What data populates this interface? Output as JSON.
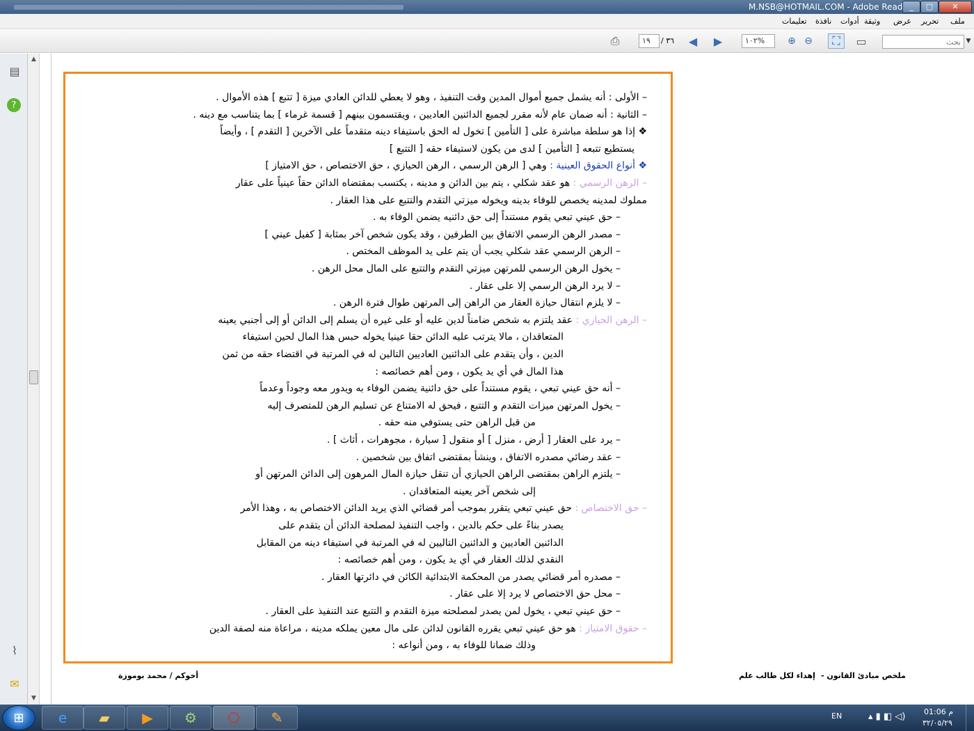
{
  "window": {
    "title": "M.NSB@HOTMAIL.COM - Adobe Reader",
    "min": "_",
    "max": "□",
    "close": "✕"
  },
  "menu": [
    "ملف",
    "تحرير",
    "عرض",
    "وثيقة",
    "أدوات",
    "نافذة",
    "تعليمات"
  ],
  "toolbar": {
    "page_current": "١٩",
    "page_total": "/ ٣٦",
    "zoom": "١٠٢%",
    "search_placeholder": "بحث"
  },
  "doc": {
    "lines": [
      {
        "t": "–   الأولى : أنه يشمل جميع أموال المدين وقت التنفيذ ، وهو لا يعطي للدائن العادي ميزة [ تتبع ] هذه الأموال ."
      },
      {
        "t": "–   الثانية : أنه ضمان عام لأنه مقرر لجميع الدائنين العاديين ، ويقتسمون بينهم [ قسمة غرماء ] بما يتناسب مع دينه ."
      },
      {
        "t": "❖ إذا هو سلطة مباشرة على [ التأمين ] تخول له الحق باستيفاء دينه متقدماً على الآخرين [ التقدم ] ، وأيضاً"
      },
      {
        "t": "يستطيع تتبعه [ التأمين ] لدى من يكون لاستيفاء حقه [ التتبع ]",
        "r": 18
      },
      {
        "h": "❖ أنواع الحقوق العينية : ",
        "hc": "hd2",
        "t": "وهي [ الرهن الرسمي ، الرهن الحيازي ، حق الاختصاص ، حق الامتياز ]"
      },
      {
        "h": "–   الرهن الرسمي : ",
        "hc": "hd",
        "t": "هو عقد شكلي ، يتم بين الدائن و مدينه ، يكتسب بمقتضاه الدائن حقاً عينياً على عقار"
      },
      {
        "t": "مملوك لمدينه يخصص للوفاء بدينه ويخوله ميزتي التقدم والتتبع على هذا العقار .",
        "r": 0
      },
      {
        "t": "–   حق عيني تبعي يقوم مستنداً إلى حق دائنيه يضمن الوفاء به .",
        "r": 38
      },
      {
        "t": "–   مصدر الرهن الرسمي الاتفاق بين الطرفين ، وقد يكون شخص آخر بمثابة [ كفيل عيني ]",
        "r": 38
      },
      {
        "t": "–   الرهن الرسمي عقد شكلي يجب أن يتم على يد الموظف المختص .",
        "r": 38
      },
      {
        "t": "–   يخول الرهن الرسمي للمرتهن ميزتي التقدم والتتبع على المال محل الرهن .",
        "r": 38
      },
      {
        "t": "–   لا يرد الرهن الرسمي إلا على عقار .",
        "r": 38
      },
      {
        "t": "–   لا يلزم انتقال حيازة العقار من الراهن إلى المرتهن طوال فترة الرهن .",
        "r": 38
      },
      {
        "h": "–   الرهن الحيازي : ",
        "hc": "hd",
        "t": "عقد يلتزم به شخص ضامناً لدين عليه أو على غيره أن يسلم إلى الدائن أو إلى أجنبي يعينه"
      },
      {
        "t": "المتعاقدان ، مالا يترتب عليه الدائن حقا عينيا يخوله حبس هذا المال لحين استيفاء",
        "r": 120
      },
      {
        "t": "الدين ، وأن يتقدم على الدائنين العاديين التالين له في المرتبة في اقتضاء حقه من ثمن",
        "r": 120
      },
      {
        "t": "هذا المال في أي يد يكون ، ومن أهم خصائصه :",
        "r": 120
      },
      {
        "t": "–   أنه حق عيني تبعي ، يقوم مستنداً على حق دائنية يضمن الوفاء به ويدور معه وجوداً وعدماً",
        "r": 38
      },
      {
        "t": "–   يخول المرتهن ميزات التقدم و التتبع ، فيحق له الامتناع عن تسليم الرهن للمتصرف إليه",
        "r": 38
      },
      {
        "t": "من قبل الراهن حتى يستوفي منه حقه .",
        "r": 160
      },
      {
        "t": "–   يرد على العقار [ أرض ، منزل ] أو منقول [ سيارة ، مجوهرات ، أثاث ] .",
        "r": 38
      },
      {
        "t": "–   عقد رضائي مصدره الاتفاق ، وينشأ بمقتضى اتفاق بين شخصين .",
        "r": 38
      },
      {
        "t": "–   يلتزم الراهن بمقتضى الراهن الحيازي أن تنقل حيازة المال المرهون إلى الدائن المرتهن أو",
        "r": 38
      },
      {
        "t": "إلى شخص آخر يعينه المتعاقدان .",
        "r": 160
      },
      {
        "h": "–   حق الاختصاص : ",
        "hc": "hd",
        "t": "حق عيني تبعي يتقرر بموجب أمر قضائي الذي يريد الدائن الاختصاص به ، وهذا الأمر"
      },
      {
        "t": "يصدر بناءً على حكم بالدين ، واجب التنفيذ لمصلحة الدائن أن يتقدم على",
        "r": 120
      },
      {
        "t": "الدائنين العاديين و الدائنين التاليين له في المرتبة في استيفاء دينه من المقابل",
        "r": 120
      },
      {
        "t": "النقدي لذلك العقار في أي يد يكون ، ومن أهم خصائصه :",
        "r": 120
      },
      {
        "t": "–   مصدره أمر قضائي يصدر من المحكمة الابتدائية الكائن في دائرتها العقار .",
        "r": 38
      },
      {
        "t": "–   محل حق الاختصاص لا يرد إلا على عقار .",
        "r": 38
      },
      {
        "t": "–   حق عيني تبعي ، يخول لمن يصدر لمصلحته ميزة التقدم و التتبع عند التنفيذ على العقار .",
        "r": 38
      },
      {
        "h": "–   حقوق الامتياز : ",
        "hc": "hd",
        "t": "هو حق عيني تبعي يقرره القانون لدائن على مال معين يملكه مدينه ، مراعاة منه لصفة الدين"
      },
      {
        "t": "وذلك ضمانا للوفاء به ، ومن أنواعه :",
        "r": 160
      }
    ]
  },
  "footer": {
    "left": "أخوكم / محمد بوموزة",
    "mid": "إهداء لكل طالب علم",
    "right": "ملخص مبادئ القانون  -"
  },
  "taskbar": {
    "lang": "EN",
    "time": "01:06 م",
    "date": "٣٢/٠٥/٢٩"
  }
}
